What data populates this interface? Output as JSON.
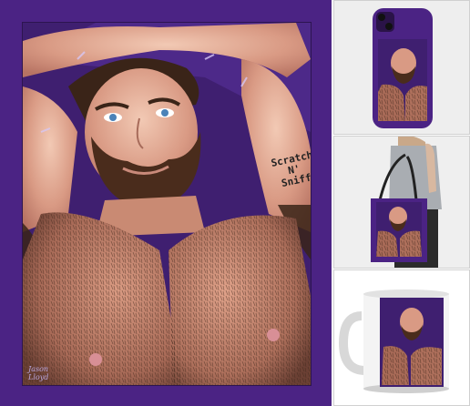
{
  "artwork": {
    "caption_line1": "Scratch",
    "caption_line2": "N'",
    "caption_line3": "Sniff",
    "signature_line1": "Jason",
    "signature_line2": "Lloyd"
  },
  "colors": {
    "brand_purple": "#4b2384",
    "bg_light": "#f0f0f0"
  },
  "products": [
    {
      "name": "phone-case"
    },
    {
      "name": "tote-bag"
    },
    {
      "name": "mug"
    }
  ]
}
